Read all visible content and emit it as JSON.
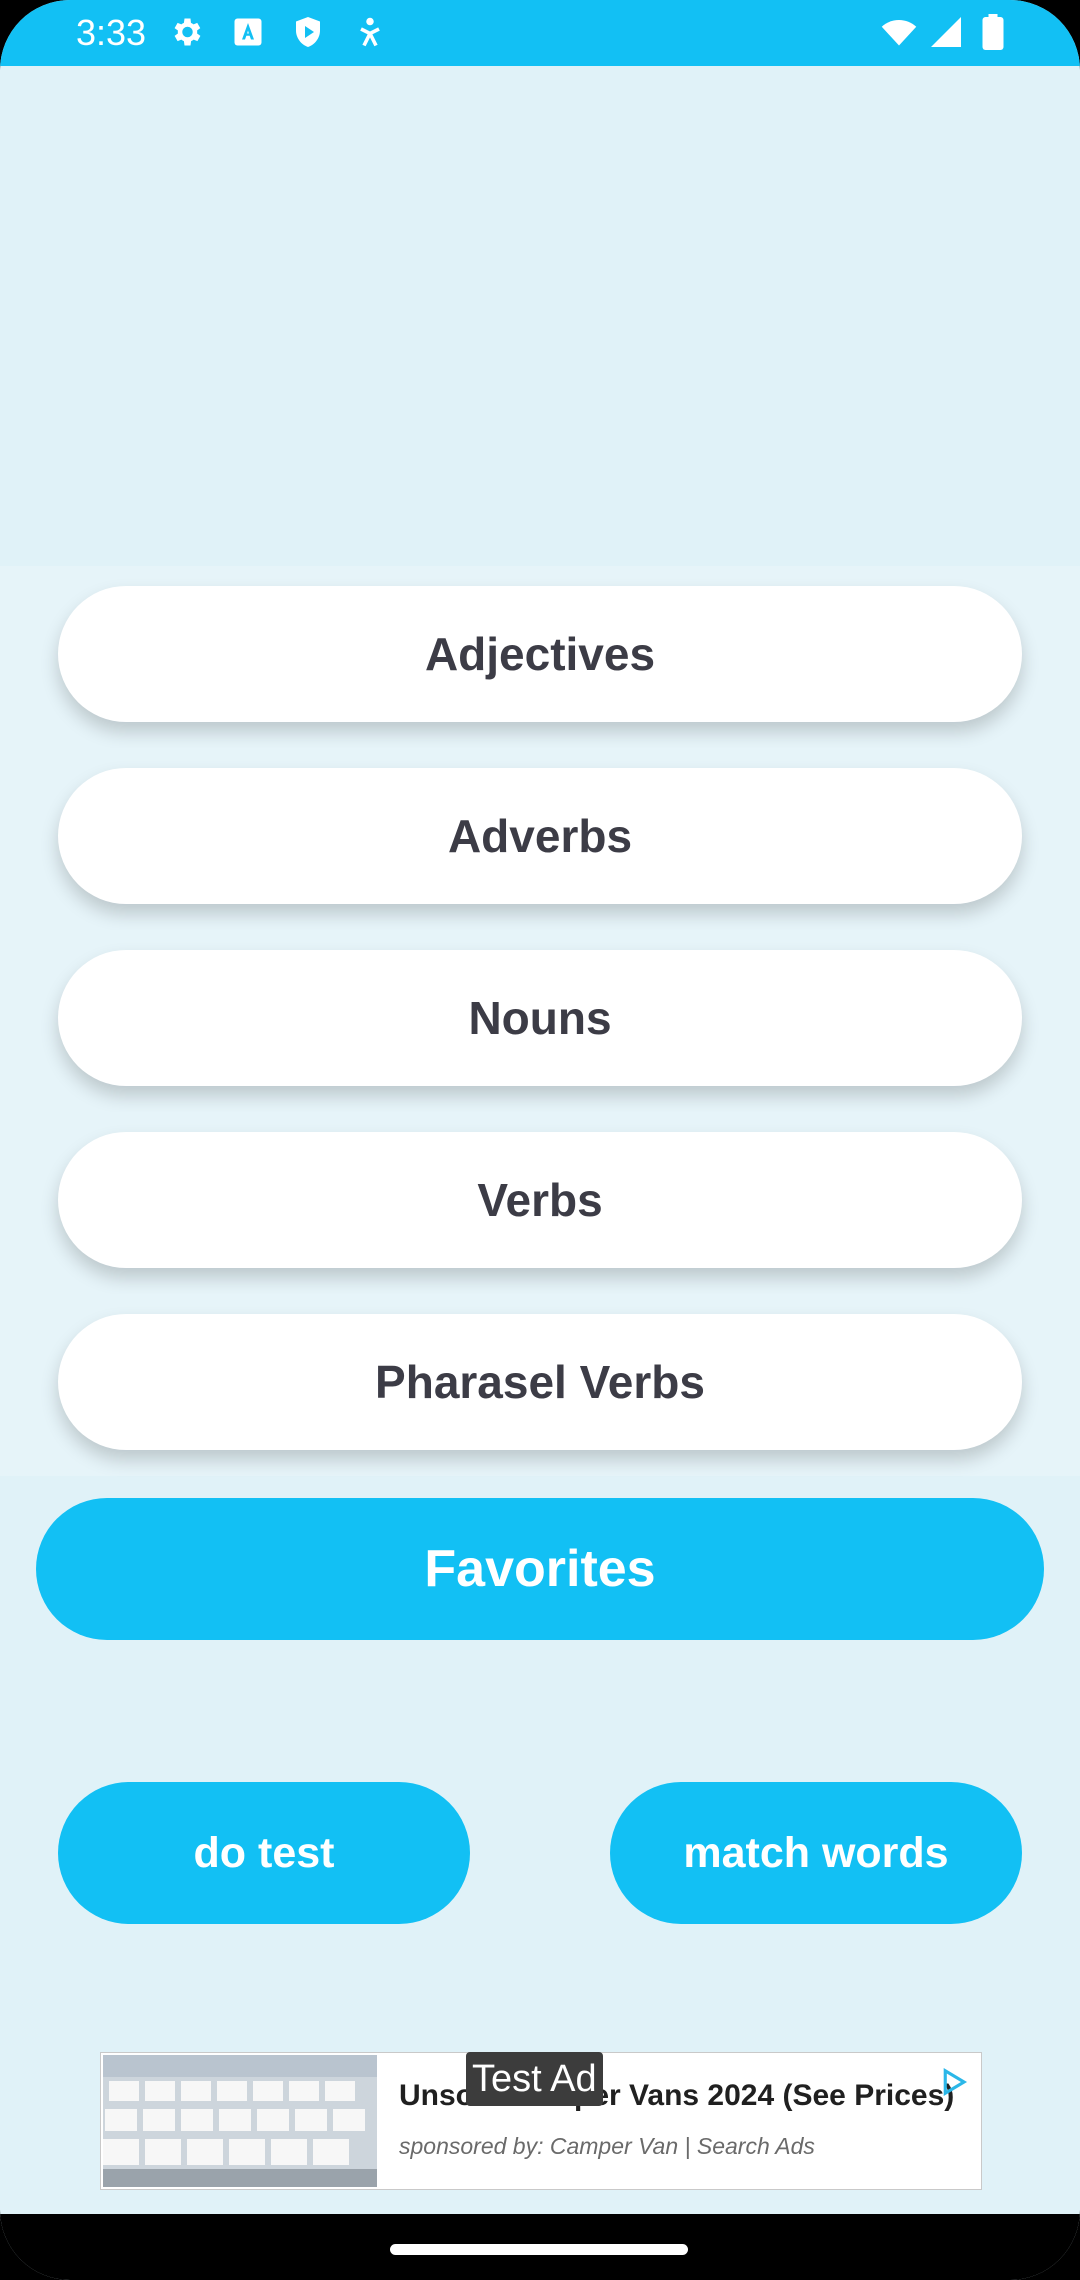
{
  "status_bar": {
    "time": "3:33",
    "left_icons": [
      "gear-icon",
      "a-icon",
      "shield-play-icon",
      "accessibility-icon"
    ],
    "right_icons": [
      "wifi-icon",
      "signal-icon",
      "battery-icon"
    ]
  },
  "categories": [
    {
      "label": "Adjectives"
    },
    {
      "label": "Adverbs"
    },
    {
      "label": "Nouns"
    },
    {
      "label": "Verbs"
    },
    {
      "label": "Pharasel Verbs"
    }
  ],
  "favorites": {
    "label": "Favorites"
  },
  "actions": {
    "do_test": "do test",
    "match_words": "match words"
  },
  "ad": {
    "badge": "Test Ad",
    "headline": "Unsold Camper Vans 2024 (See Prices)",
    "sponsor": "sponsored by: Camper Van | Search Ads"
  },
  "colors": {
    "accent": "#12c0f4",
    "background": "#e0f2f8",
    "button_text": "#3c3c46"
  }
}
